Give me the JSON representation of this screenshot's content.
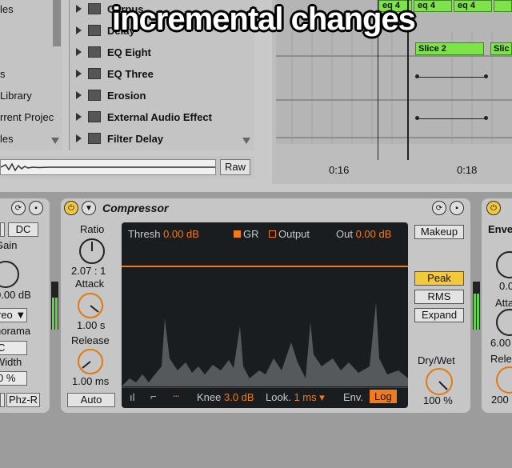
{
  "overlay_caption": "incremental changes",
  "browser": {
    "left_items": [
      "les",
      "s",
      "Library",
      "rrent Projec",
      "les"
    ],
    "devices": [
      "Corpus",
      "Delay",
      "EQ Eight",
      "EQ Three",
      "Erosion",
      "External Audio Effect",
      "Filter Delay"
    ],
    "raw_label": "Raw"
  },
  "arrangement": {
    "clip_labels": [
      "eq 4",
      "eq 4",
      "eq 4"
    ],
    "slice_labels": [
      "Slice 2",
      "Slic"
    ],
    "time_labels": [
      "0:16",
      "0:18"
    ]
  },
  "utility": {
    "dc_label": "DC",
    "gain_label": "Gain",
    "gain_value": "0.00 dB",
    "stereo_value": "reo",
    "panorama_label": "norama",
    "pan_value": "C",
    "width_label": "Width",
    "width_value": "0 %",
    "phz_label": "Phz-R"
  },
  "compressor": {
    "title": "Compressor",
    "ratio_label": "Ratio",
    "ratio_value": "2.07 : 1",
    "attack_label": "Attack",
    "attack_value": "1.00 s",
    "release_label": "Release",
    "release_value": "1.00 ms",
    "auto_label": "Auto",
    "thresh_label": "Thresh",
    "thresh_value": "0.00 dB",
    "gr_label": "GR",
    "output_label": "Output",
    "out_label": "Out",
    "out_value": "0.00 dB",
    "knee_label": "Knee",
    "knee_value": "3.0 dB",
    "look_label": "Look.",
    "look_value": "1 ms",
    "env_label": "Env.",
    "log_label": "Log",
    "makeup_label": "Makeup",
    "peak_label": "Peak",
    "rms_label": "RMS",
    "expand_label": "Expand",
    "drywet_label": "Dry/Wet",
    "drywet_value": "100 %"
  },
  "next_device": {
    "title": "Enve",
    "value1": "0.0",
    "attack_label": "Atta",
    "attack_value": "6.00",
    "release_label": "Rele",
    "release_value": "200"
  },
  "colors": {
    "accent_orange": "#f07a1e",
    "clip_green": "#7ee24a",
    "peak_yellow": "#f4c83b"
  }
}
